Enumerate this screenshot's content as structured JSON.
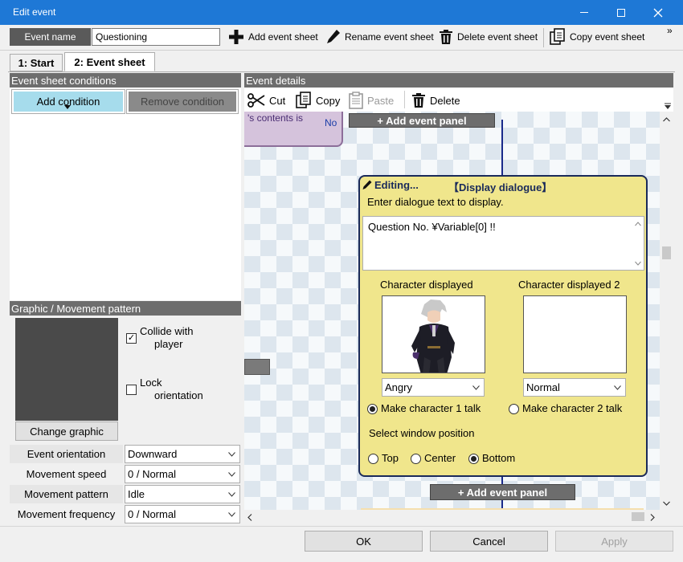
{
  "window": {
    "title": "Edit event"
  },
  "toolbar": {
    "event_name_label": "Event name",
    "event_name_value": "Questioning",
    "add_sheet": "Add event sheet",
    "rename_sheet": "Rename event sheet",
    "delete_sheet": "Delete event sheet",
    "copy_sheet": "Copy event sheet",
    "more": "»"
  },
  "tabs": [
    {
      "label": "1: Start"
    },
    {
      "label": "2: Event sheet"
    }
  ],
  "conditions": {
    "header": "Event sheet conditions",
    "add": "Add condition",
    "remove": "Remove condition"
  },
  "graphic": {
    "header": "Graphic / Movement pattern",
    "collide_line1": "Collide  with",
    "collide_line2": "player",
    "lock_line1": "Lock",
    "lock_line2": "orientation",
    "change": "Change graphic",
    "collide_checked": true,
    "lock_checked": false
  },
  "props": [
    {
      "label": "Event orientation",
      "value": "Downward"
    },
    {
      "label": "Movement speed",
      "value": "0 / Normal"
    },
    {
      "label": "Movement pattern",
      "value": "Idle"
    },
    {
      "label": "Movement frequency",
      "value": "0 / Normal"
    }
  ],
  "details": {
    "header": "Event details",
    "cut": "Cut",
    "copy": "Copy",
    "paste": "Paste",
    "delete": "Delete",
    "prev_panel_text": "'s contents is",
    "prev_panel_no": "No",
    "add_panel_top": "+ Add event panel",
    "add_panel_bottom": "+ Add event panel"
  },
  "dialog": {
    "editing": "Editing...",
    "type": "【Display dialogue】",
    "instruction": "Enter dialogue text to display.",
    "text": "Question No. ¥Variable[0] !!",
    "char1_label": "Character displayed",
    "char2_label": "Character displayed 2",
    "char1_expr": "Angry",
    "char2_expr": "Normal",
    "talk1": "Make character 1 talk",
    "talk2": "Make character 2 talk",
    "window_pos_label": "Select window position",
    "pos_top": "Top",
    "pos_center": "Center",
    "pos_bottom": "Bottom"
  },
  "footer": {
    "ok": "OK",
    "cancel": "Cancel",
    "apply": "Apply"
  },
  "colors": {
    "titlebar": "#1e78d6",
    "dialog_bg": "#f0e68c",
    "add_condition_bg": "#a6dcec",
    "section_header": "#6d6d6d"
  }
}
